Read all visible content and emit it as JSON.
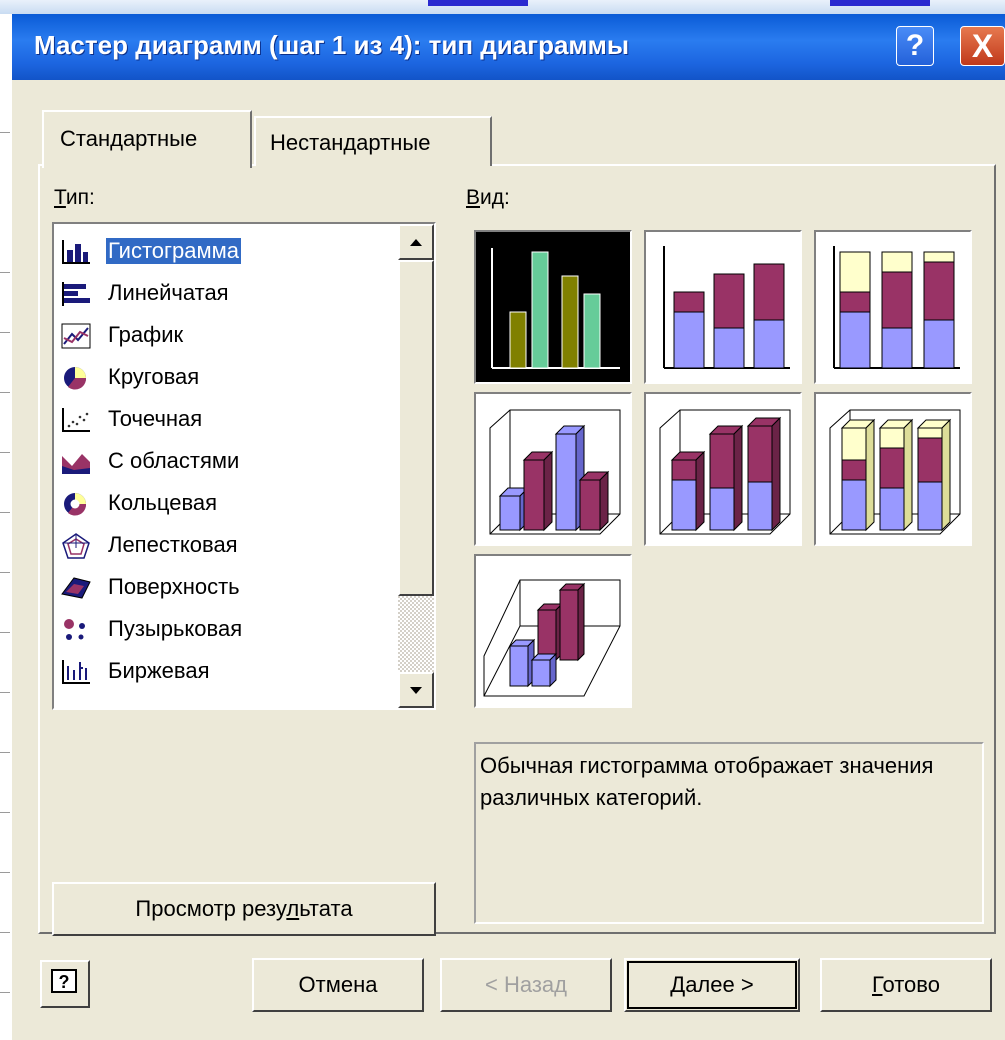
{
  "window": {
    "title": "Мастер диаграмм (шаг 1 из 4): тип диаграммы",
    "help_button": "?",
    "close_button": "X"
  },
  "tabs": [
    {
      "label": "Стандартные",
      "active": true
    },
    {
      "label": "Нестандартные",
      "active": false
    }
  ],
  "type_section": {
    "label": "Тип:",
    "items": [
      {
        "label": "Гистограмма",
        "icon": "column-chart-icon",
        "selected": true
      },
      {
        "label": "Линейчатая",
        "icon": "bar-chart-icon"
      },
      {
        "label": "График",
        "icon": "line-chart-icon"
      },
      {
        "label": "Круговая",
        "icon": "pie-chart-icon"
      },
      {
        "label": "Точечная",
        "icon": "scatter-chart-icon"
      },
      {
        "label": "С областями",
        "icon": "area-chart-icon"
      },
      {
        "label": "Кольцевая",
        "icon": "doughnut-chart-icon"
      },
      {
        "label": "Лепестковая",
        "icon": "radar-chart-icon"
      },
      {
        "label": "Поверхность",
        "icon": "surface-chart-icon"
      },
      {
        "label": "Пузырьковая",
        "icon": "bubble-chart-icon"
      },
      {
        "label": "Биржевая",
        "icon": "stock-chart-icon"
      }
    ]
  },
  "view_section": {
    "label": "Вид:",
    "subtypes": [
      {
        "icon": "clustered-column-icon",
        "selected": true
      },
      {
        "icon": "stacked-column-icon"
      },
      {
        "icon": "percent-stacked-column-icon"
      },
      {
        "icon": "clustered-column-3d-icon"
      },
      {
        "icon": "stacked-column-3d-icon"
      },
      {
        "icon": "percent-stacked-column-3d-icon"
      },
      {
        "icon": "column-3d-icon"
      }
    ],
    "description": "Обычная гистограмма отображает значения различных категорий."
  },
  "buttons": {
    "preview": "Просмотр результата",
    "cancel": "Отмена",
    "back": "< Назад",
    "next": "Далее >",
    "finish": "Готово",
    "help_icon": "?"
  },
  "colors": {
    "titlebar": "#1c65e0",
    "selection": "#316ac5",
    "dialog_bg": "#ece9d8",
    "series_purple": "#993366",
    "series_blue": "#9999ff",
    "series_cream": "#ffffcc",
    "series_olive": "#808000",
    "series_teal": "#66cc99"
  }
}
